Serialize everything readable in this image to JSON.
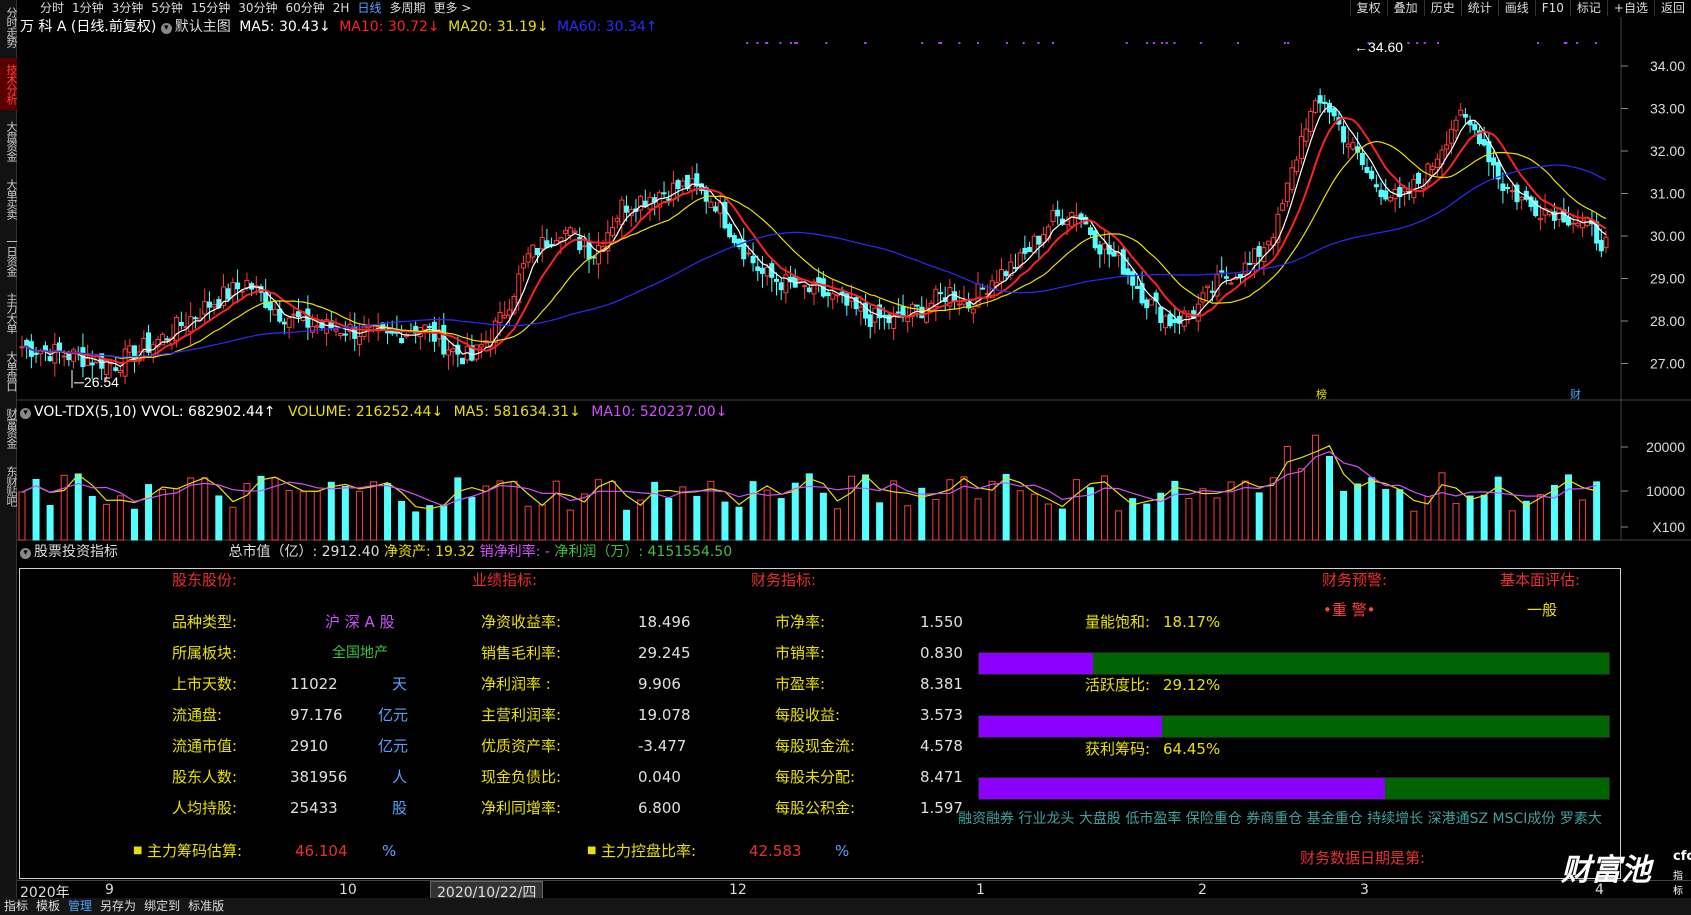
{
  "left_tabs": [
    {
      "label": "分时走势",
      "active": false
    },
    {
      "label": "技术分析",
      "active": true
    },
    {
      "label": "大盘资金",
      "active": false
    },
    {
      "label": "大单买卖",
      "active": false
    },
    {
      "label": "一日资金",
      "active": false
    },
    {
      "label": "主力大单",
      "active": false
    },
    {
      "label": "大单盘口",
      "active": false
    },
    {
      "label": "财富资金",
      "active": false
    },
    {
      "label": "东财贴吧",
      "active": false
    }
  ],
  "periods": [
    "分时",
    "1分钟",
    "3分钟",
    "5分钟",
    "15分钟",
    "30分钟",
    "60分钟",
    "2H",
    "日线",
    "多周期",
    "更多 >"
  ],
  "selected_period": "日线",
  "toolbar": [
    "复权",
    "叠加",
    "历史",
    "统计",
    "画线",
    "F10",
    "标记",
    "+自选",
    "返回"
  ],
  "main_legend": {
    "title": "万 科 A (日线.前复权)",
    "template": "默认主图",
    "ma5": "MA5: 30.43↓",
    "ma10": "MA10: 30.72↓",
    "ma20": "MA20: 31.19↓",
    "ma60": "MA60: 30.34↑"
  },
  "price_axis": [
    "34.00",
    "33.00",
    "32.00",
    "31.00",
    "30.00",
    "29.00",
    "28.00",
    "27.00"
  ],
  "price_marks": {
    "high": "34.60",
    "low": "26.54",
    "badge_left": "榜",
    "badge_right": "财"
  },
  "vol_legend": {
    "name": "VOL-TDX(5,10)",
    "vvol": "VVOL: 682902.44↑",
    "volume": "VOLUME: 216252.44↓",
    "ma5": "MA5: 581634.31↓",
    "ma10": "MA10: 520237.00↓"
  },
  "vol_axis": [
    "20000",
    "10000",
    "X100"
  ],
  "ind_legend": {
    "name": "股票投资指标",
    "market_cap": "总市值（亿）: 2912.40",
    "net_assets": "净资产: 19.32",
    "net_margin": "销净利率: -",
    "net_profit": "净利润（万）: 4151554.50"
  },
  "panel": {
    "headers": {
      "holders": "股东股份:",
      "performance": "业绩指标:",
      "finance": "财务指标:",
      "warning": "财务预警:",
      "fundamental": "基本面评估:"
    },
    "holders": [
      {
        "label": "品种类型:",
        "value": "沪 深 A 股",
        "unit": ""
      },
      {
        "label": "所属板块:",
        "value": "全国地产",
        "unit": ""
      },
      {
        "label": "上市天数:",
        "value": "11022",
        "unit": "天"
      },
      {
        "label": "流通盘:",
        "value": "97.176",
        "unit": "亿元"
      },
      {
        "label": "流通市值:",
        "value": "2910",
        "unit": "亿元"
      },
      {
        "label": "股东人数:",
        "value": "381956",
        "unit": "人"
      },
      {
        "label": "人均持股:",
        "value": "25433",
        "unit": "股"
      }
    ],
    "performance": [
      {
        "label": "净资收益率:",
        "value": "18.496"
      },
      {
        "label": "销售毛利率:",
        "value": "29.245"
      },
      {
        "label": "净利润率 :",
        "value": "9.906"
      },
      {
        "label": "主营利润率:",
        "value": "19.078"
      },
      {
        "label": "优质资产率:",
        "value": "-3.477"
      },
      {
        "label": "现金负债比:",
        "value": "0.040"
      },
      {
        "label": "净利同增率:",
        "value": "6.800"
      }
    ],
    "finance": [
      {
        "label": "市净率:",
        "value": "1.550"
      },
      {
        "label": "市销率:",
        "value": "0.830"
      },
      {
        "label": "市盈率:",
        "value": "8.381"
      },
      {
        "label": "每股收益:",
        "value": "3.573"
      },
      {
        "label": "每股现金流:",
        "value": "4.578"
      },
      {
        "label": "每股未分配:",
        "value": "8.471"
      },
      {
        "label": "每股公积金:",
        "value": "1.597"
      }
    ],
    "warning_value": "•重 警•",
    "fundamental_value": "一般",
    "bars": [
      {
        "label": "量能饱和:",
        "value": "18.17%",
        "fraction": 0.1817
      },
      {
        "label": "活跃度比:",
        "value": "29.12%",
        "fraction": 0.2912
      },
      {
        "label": "获利筹码:",
        "value": "64.45%",
        "fraction": 0.6445
      }
    ],
    "tags": "融资融券 行业龙头 大盘股 低市盈率 保险重仓 券商重仓 基金重仓 持续增长 深港通SZ MSCI成份 罗素大",
    "chip_estimate": {
      "label": "主力筹码估算:",
      "value": "46.104",
      "unit": "%"
    },
    "control_ratio": {
      "label": "主力控盘比率:",
      "value": "42.583",
      "unit": "%"
    },
    "report_date": "财务数据日期是第:"
  },
  "time_axis": {
    "year": "2020年",
    "months": [
      "9",
      "10",
      "12",
      "1",
      "2",
      "3",
      "4"
    ],
    "cursor_date": "2020/10/22/四"
  },
  "status_bar": [
    "指标",
    "模板",
    "管理",
    "另存为",
    "绑定到",
    "标准版"
  ],
  "status_selected": "管理",
  "logo": {
    "text": "财富池",
    "domain": "cfchi.com",
    "sub": "指标交易平台"
  },
  "colors": {
    "up": "#ff3c3c",
    "down": "#54ffff",
    "ma5": "#ffffff",
    "ma10": "#ff2020",
    "ma20": "#e8e000",
    "ma60": "#2a2aff",
    "vol_ma5": "#e8e000",
    "vol_ma10": "#d050ff"
  }
}
